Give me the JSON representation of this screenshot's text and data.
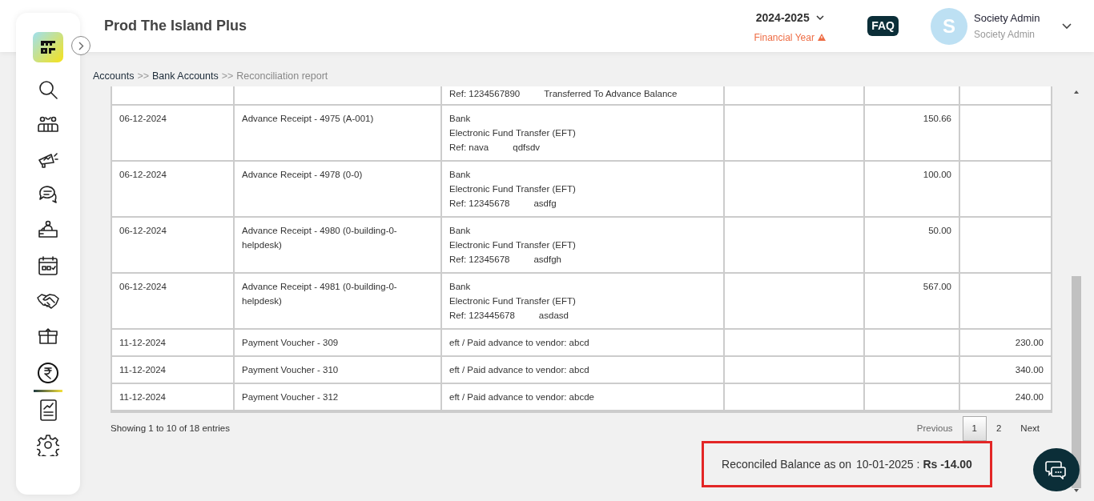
{
  "header": {
    "title": "Prod The Island Plus",
    "year": "2024-2025",
    "year_note": "Financial Year",
    "faq": "FAQ",
    "avatar_letter": "S",
    "user_name": "Society Admin",
    "user_role": "Society Admin"
  },
  "sidebar": {
    "items": [
      {
        "kind": "search",
        "selected": false
      },
      {
        "kind": "people",
        "selected": false
      },
      {
        "kind": "megaphone",
        "selected": false
      },
      {
        "kind": "chat",
        "selected": false
      },
      {
        "kind": "desk",
        "selected": false
      },
      {
        "kind": "calendar",
        "selected": false
      },
      {
        "kind": "handshake",
        "selected": false
      },
      {
        "kind": "box",
        "selected": false
      },
      {
        "kind": "rupee",
        "selected": true
      },
      {
        "kind": "report",
        "selected": false
      },
      {
        "kind": "gear",
        "selected": false
      }
    ]
  },
  "breadcrumb": [
    {
      "label": "Accounts",
      "current": false
    },
    {
      "label": "Bank Accounts",
      "current": false
    },
    {
      "label": "Reconciliation report",
      "current": true
    }
  ],
  "breadcrumb_separators": [
    ">>",
    ">>"
  ],
  "table": {
    "rows": [
      {
        "date": "",
        "particular": "",
        "details": [],
        "ref": "Ref: 1234567890",
        "note": "Transferred To Advance Balance",
        "column_4": "",
        "debit": "",
        "credit": ""
      },
      {
        "date": "06-12-2024",
        "particular": "Advance Receipt - 4975 (A-001)",
        "details": [
          "Bank",
          "Electronic Fund Transfer (EFT)"
        ],
        "ref": "Ref: nava",
        "note": "qdfsdv",
        "column_4": "",
        "debit": "150.66",
        "credit": ""
      },
      {
        "date": "06-12-2024",
        "particular": "Advance Receipt - 4978 (0-0)",
        "details": [
          "Bank",
          "Electronic Fund Transfer (EFT)"
        ],
        "ref": "Ref: 12345678",
        "note": "asdfg",
        "column_4": "",
        "debit": "100.00",
        "credit": ""
      },
      {
        "date": "06-12-2024",
        "particular": "Advance Receipt - 4980 (0-building-0-helpdesk)",
        "details": [
          "Bank",
          "Electronic Fund Transfer (EFT)"
        ],
        "ref": "Ref: 12345678",
        "note": "asdfgh",
        "column_4": "",
        "debit": "50.00",
        "credit": ""
      },
      {
        "date": "06-12-2024",
        "particular": "Advance Receipt - 4981 (0-building-0-helpdesk)",
        "details": [
          "Bank",
          "Electronic Fund Transfer (EFT)"
        ],
        "ref": "Ref: 123445678",
        "note": "asdasd",
        "column_4": "",
        "debit": "567.00",
        "credit": ""
      },
      {
        "date": "11-12-2024",
        "particular": "Payment Voucher - 309",
        "details": [
          "eft / Paid advance to vendor: abcd"
        ],
        "ref": "",
        "note": "",
        "column_4": "",
        "debit": "",
        "credit": "230.00"
      },
      {
        "date": "11-12-2024",
        "particular": "Payment Voucher - 310",
        "details": [
          "eft / Paid advance to vendor: abcd"
        ],
        "ref": "",
        "note": "",
        "column_4": "",
        "debit": "",
        "credit": "340.00"
      },
      {
        "date": "11-12-2024",
        "particular": "Payment Voucher - 312",
        "details": [
          "eft / Paid advance to vendor: abcde"
        ],
        "ref": "",
        "note": "",
        "column_4": "",
        "debit": "",
        "credit": "240.00"
      }
    ]
  },
  "entries_info": "Showing 1 to 10 of 18 entries",
  "pagination": [
    {
      "label": "Previous",
      "kind": "prev",
      "selected": false
    },
    {
      "label": "1",
      "kind": "page",
      "selected": true
    },
    {
      "label": "2",
      "kind": "page",
      "selected": false
    },
    {
      "label": "Next",
      "kind": "next",
      "selected": false
    }
  ],
  "balance": {
    "label": "Reconciled Balance as on",
    "date": "10-01-2025 :",
    "amount": "Rs -14.00"
  }
}
